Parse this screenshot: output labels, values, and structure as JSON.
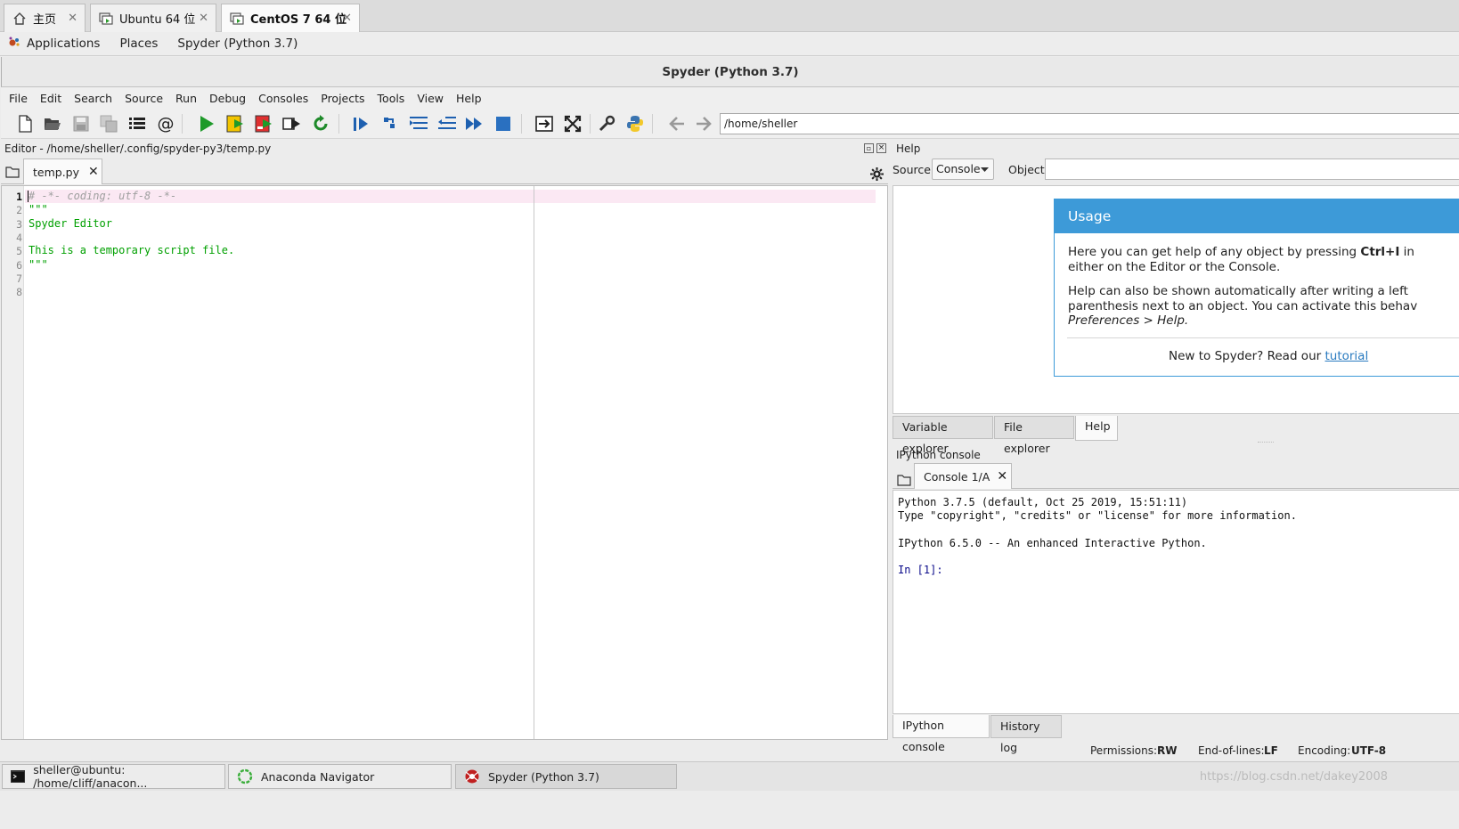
{
  "vm_tabs": [
    {
      "label": "主页",
      "icon": "home-icon"
    },
    {
      "label": "Ubuntu 64 位",
      "icon": "vm-icon"
    },
    {
      "label": "CentOS 7 64 位",
      "icon": "vm-icon",
      "active": true
    }
  ],
  "vm_tab_close": "✕",
  "gnome_bar": {
    "applications": "Applications",
    "places": "Places",
    "window": "Spyder (Python 3.7)"
  },
  "window_title": "Spyder (Python 3.7)",
  "menu": [
    "File",
    "Edit",
    "Search",
    "Source",
    "Run",
    "Debug",
    "Consoles",
    "Projects",
    "Tools",
    "View",
    "Help"
  ],
  "toolbar": {
    "icons": [
      "new-file-icon",
      "open-file-icon",
      "save-icon",
      "save-all-icon",
      "outline-icon",
      "at-icon",
      "run-icon",
      "run-cell-icon",
      "run-cell-advance-icon",
      "run-selection-icon",
      "rerun-icon",
      "debug-icon",
      "step-icon",
      "step-into-icon",
      "step-return-icon",
      "continue-icon",
      "stop-icon",
      "maximize-pane-icon",
      "fullscreen-icon",
      "preferences-icon",
      "python-path-icon",
      "back-icon",
      "forward-icon"
    ],
    "path": "/home/sheller"
  },
  "editor": {
    "title": "Editor - /home/sheller/.config/spyder-py3/temp.py",
    "tab": "temp.py",
    "lines": [
      {
        "n": "1",
        "text": "# -*- coding: utf-8 -*-",
        "kind": "comment"
      },
      {
        "n": "2",
        "text": "\"\"\"",
        "kind": "string"
      },
      {
        "n": "3",
        "text": "Spyder Editor",
        "kind": "string"
      },
      {
        "n": "4",
        "text": "",
        "kind": "string"
      },
      {
        "n": "5",
        "text": "This is a temporary script file.",
        "kind": "string"
      },
      {
        "n": "6",
        "text": "\"\"\"",
        "kind": "string"
      },
      {
        "n": "7",
        "text": "",
        "kind": "string"
      },
      {
        "n": "8",
        "text": "",
        "kind": "string"
      }
    ]
  },
  "help": {
    "title": "Help",
    "source_label": "Source",
    "source_value": "Console",
    "object_label": "Object",
    "usage": {
      "heading": "Usage",
      "p1a": "Here you can get help of any object by pressing ",
      "p1b": "Ctrl+I",
      "p1c": " in",
      "p1d": "either on the Editor or the Console.",
      "p2a": "Help can also be shown automatically after writing a left",
      "p2b": "parenthesis next to an object. You can activate this behav",
      "p2c": "Preferences > Help.",
      "p3a": "New to Spyder? Read our ",
      "p3link": "tutorial"
    },
    "tabs": [
      "Variable explorer",
      "File explorer",
      "Help"
    ]
  },
  "console": {
    "title": "IPython console",
    "tab": "Console 1/A",
    "lines": [
      "Python 3.7.5 (default, Oct 25 2019, 15:51:11)",
      "Type \"copyright\", \"credits\" or \"license\" for more information.",
      "",
      "IPython 6.5.0 -- An enhanced Interactive Python.",
      "",
      "In [1]:"
    ],
    "bottom_tabs": [
      "IPython console",
      "History log"
    ]
  },
  "status": {
    "permissions_label": "Permissions:",
    "permissions": "RW",
    "eol_label": "End-of-lines:",
    "eol": "LF",
    "encoding_label": "Encoding:",
    "encoding": "UTF-8"
  },
  "taskbar": [
    {
      "label": "sheller@ubuntu: /home/cliff/anacon...",
      "icon": "terminal-icon"
    },
    {
      "label": "Anaconda Navigator",
      "icon": "anaconda-icon"
    },
    {
      "label": "Spyder (Python 3.7)",
      "icon": "spyder-icon"
    }
  ],
  "watermark": "https://blog.csdn.net/dakey2008"
}
